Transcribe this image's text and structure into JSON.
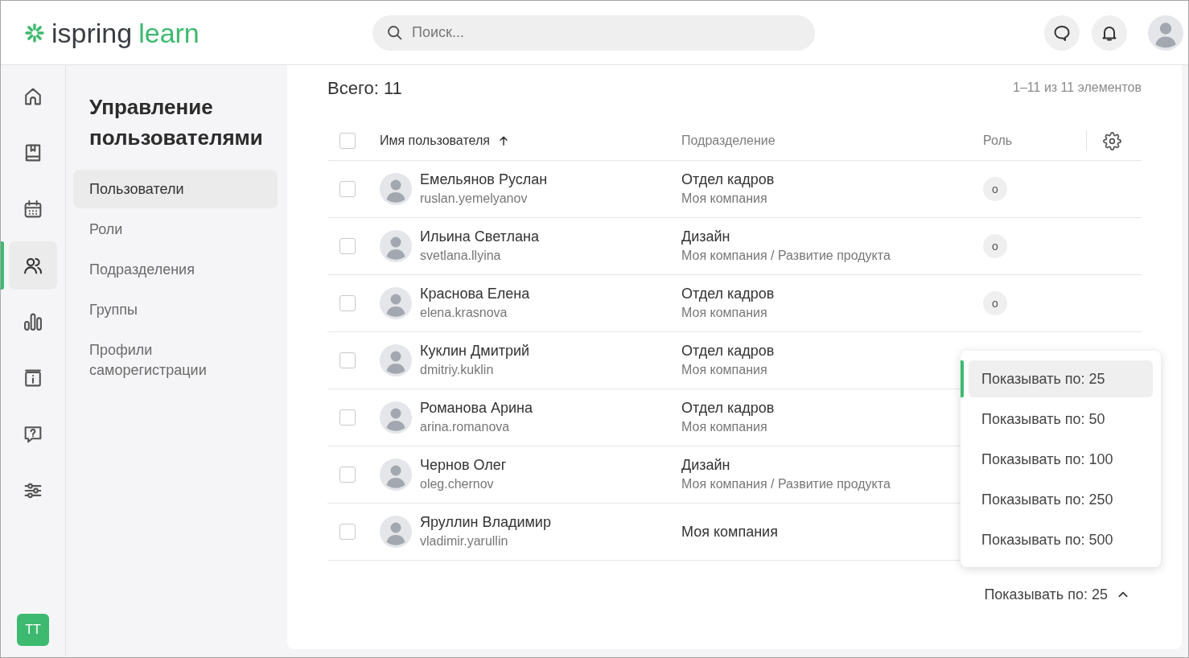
{
  "header": {
    "logo": {
      "brand": "ispring",
      "product": "learn"
    },
    "search": {
      "placeholder": "Поиск..."
    }
  },
  "nav_rail": [
    {
      "selected": false
    },
    {
      "selected": false
    },
    {
      "selected": false
    },
    {
      "selected": true
    },
    {
      "selected": false
    },
    {
      "selected": false
    },
    {
      "selected": false
    },
    {
      "selected": false
    }
  ],
  "user_badge": "ТТ",
  "sidebar": {
    "title": "Управление пользователями",
    "items": [
      {
        "label": "Пользователи",
        "selected": true
      },
      {
        "label": "Роли",
        "selected": false
      },
      {
        "label": "Подразделения",
        "selected": false
      },
      {
        "label": "Группы",
        "selected": false
      },
      {
        "label": "Профили саморегистрации",
        "selected": false
      }
    ]
  },
  "summary": {
    "total": "Всего: 11",
    "range": "1–11 из 11 элементов"
  },
  "table": {
    "select_all": {
      "checked": false
    },
    "columns": [
      {
        "label": "Имя пользователя",
        "sorted": true
      },
      {
        "label": "Подразделение",
        "sorted": false
      },
      {
        "label": "Роль",
        "sorted": false
      }
    ],
    "rows": [
      {
        "checked": false,
        "name": "Емельянов Руслан",
        "login": "ruslan.yemelyanov",
        "department": "Отдел кадров",
        "path": "Моя компания",
        "role": "о"
      },
      {
        "checked": false,
        "name": "Ильина Светлана",
        "login": "svetlana.llyina",
        "department": "Дизайн",
        "path": "Моя компания / Развитие продукта",
        "role": "о"
      },
      {
        "checked": false,
        "name": "Краснова Елена",
        "login": "elena.krasnova",
        "department": "Отдел кадров",
        "path": "Моя компания",
        "role": "о"
      },
      {
        "checked": false,
        "name": "Куклин Дмитрий",
        "login": "dmitriy.kuklin",
        "department": "Отдел кадров",
        "path": "Моя компания"
      },
      {
        "checked": false,
        "name": "Романова Арина",
        "login": "arina.romanova",
        "department": "Отдел кадров",
        "path": "Моя компания"
      },
      {
        "checked": false,
        "name": "Чернов Олег",
        "login": "oleg.chernov",
        "department": "Дизайн",
        "path": "Моя компания / Развитие продукта"
      },
      {
        "checked": false,
        "name": "Яруллин Владимир",
        "login": "vladimir.yarullin",
        "department": "Моя компания"
      }
    ]
  },
  "pagination": {
    "page_size": "Показывать по: 25",
    "expanded": true,
    "options": [
      {
        "label": "Показывать по: 25",
        "selected": true
      },
      {
        "label": "Показывать по: 50",
        "selected": false
      },
      {
        "label": "Показывать по: 100",
        "selected": false
      },
      {
        "label": "Показывать по: 250",
        "selected": false
      },
      {
        "label": "Показывать по: 500",
        "selected": false
      }
    ]
  }
}
